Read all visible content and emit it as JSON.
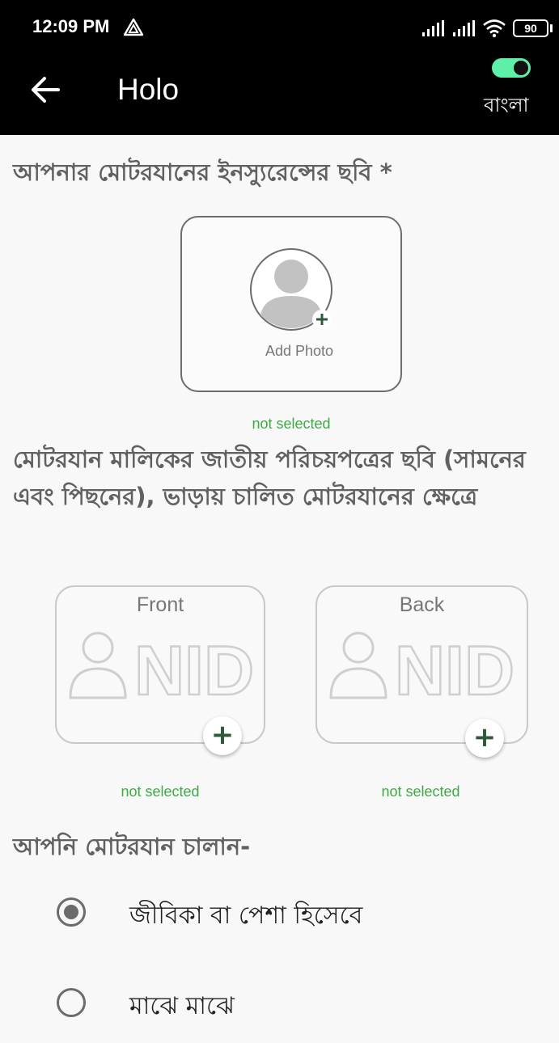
{
  "status_bar": {
    "time": "12:09 PM",
    "battery": "90",
    "icons": [
      "drive-icon",
      "signal-icon",
      "signal-icon",
      "wifi-icon",
      "battery-icon"
    ]
  },
  "app_bar": {
    "title": "Holo",
    "language_label": "বাংলা",
    "language_toggle_on": true,
    "colors": {
      "background": "#000000",
      "toggle": "#5ef0a8"
    }
  },
  "insurance_section": {
    "heading": "আপনার মোটরযানের ইনস্যুরেন্সের ছবি *",
    "add_photo_label": "Add Photo",
    "status": "not selected"
  },
  "nid_section": {
    "heading": "মোটরযান মালিকের জাতীয় পরিচয়পত্রের ছবি (সামনের এবং পিছনের), ভাড়ায় চালিত মোটরযানের ক্ষেত্রে",
    "front": {
      "caption": "Front",
      "card_text": "NID",
      "status": "not selected"
    },
    "back": {
      "caption": "Back",
      "card_text": "NID",
      "status": "not selected"
    }
  },
  "driving_section": {
    "heading": "আপনি মোটরযান চালান-",
    "options": [
      {
        "label": "জীবিকা বা পেশা হিসেবে",
        "selected": true
      },
      {
        "label": "মাঝে মাঝে",
        "selected": false
      }
    ]
  },
  "colors": {
    "status_text": "#3dab44",
    "heading": "#616161",
    "plus_icon": "#2e5a3a"
  }
}
